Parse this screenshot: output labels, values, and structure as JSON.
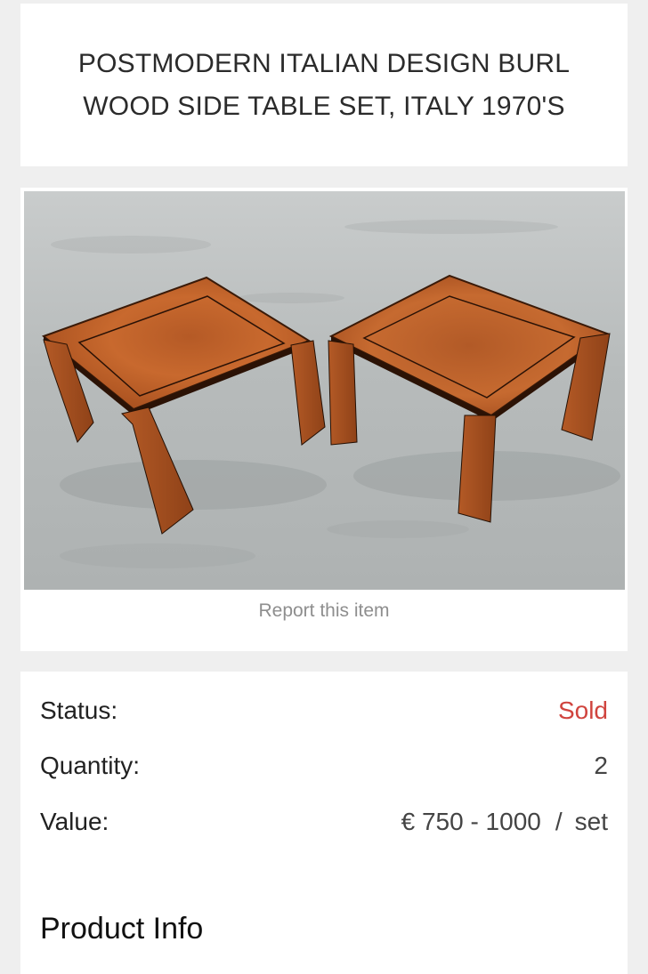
{
  "product": {
    "title": "POSTMODERN ITALIAN DESIGN BURL WOOD SIDE TABLE SET, ITALY 1970'S",
    "report_link": "Report this item"
  },
  "details": {
    "status_label": "Status:",
    "status_value": "Sold",
    "quantity_label": "Quantity:",
    "quantity_value": "2",
    "value_label": "Value:",
    "price_range": "€ 750 - 1000",
    "price_separator": "/",
    "price_unit": "set"
  },
  "sections": {
    "product_info": "Product Info"
  },
  "colors": {
    "background": "#efefef",
    "card": "#ffffff",
    "sold": "#d0443e",
    "muted": "#8e8e8e"
  }
}
